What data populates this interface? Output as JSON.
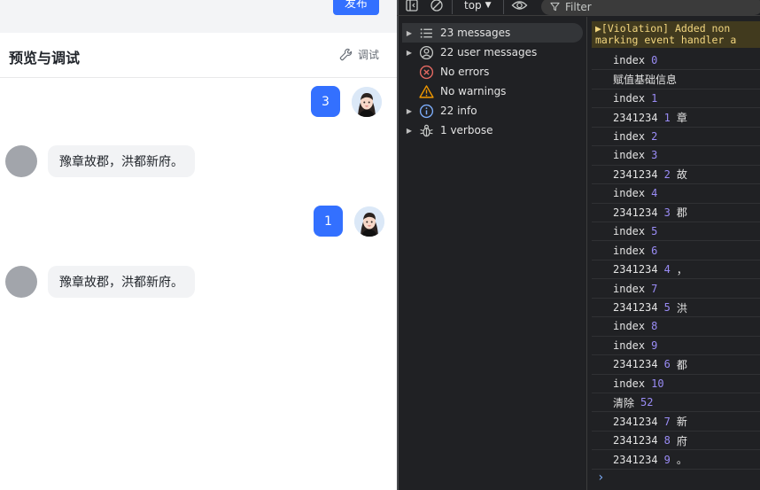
{
  "preview": {
    "publish_label": "发布",
    "title": "预览与调试",
    "debug_label": "调试",
    "messages": [
      {
        "role": "user",
        "text": "3"
      },
      {
        "role": "bot",
        "text": "豫章故郡，洪都新府。"
      },
      {
        "role": "user",
        "text": "1"
      },
      {
        "role": "bot",
        "text": "豫章故郡，洪都新府。"
      }
    ]
  },
  "devtools": {
    "context": "top",
    "filter_placeholder": "Filter",
    "sidebar": [
      {
        "label": "23 messages",
        "icon": "list-icon",
        "expandable": true,
        "active": true
      },
      {
        "label": "22 user messages",
        "icon": "user-circle-icon",
        "expandable": true
      },
      {
        "label": "No errors",
        "icon": "error-icon",
        "expandable": false
      },
      {
        "label": "No warnings",
        "icon": "warning-icon",
        "expandable": false
      },
      {
        "label": "22 info",
        "icon": "info-icon",
        "expandable": true
      },
      {
        "label": "1 verbose",
        "icon": "bug-icon",
        "expandable": true
      }
    ],
    "violation_line1": "▶[Violation] Added non",
    "violation_line2": "marking event handler a",
    "logs": [
      {
        "text": "index",
        "num": "0",
        "suffix": ""
      },
      {
        "text": "赋值基础信息",
        "num": "",
        "suffix": ""
      },
      {
        "text": "index",
        "num": "1",
        "suffix": ""
      },
      {
        "text": "2341234",
        "num": "1",
        "suffix": "章"
      },
      {
        "text": "index",
        "num": "2",
        "suffix": ""
      },
      {
        "text": "index",
        "num": "3",
        "suffix": ""
      },
      {
        "text": "2341234",
        "num": "2",
        "suffix": "故"
      },
      {
        "text": "index",
        "num": "4",
        "suffix": ""
      },
      {
        "text": "2341234",
        "num": "3",
        "suffix": "郡"
      },
      {
        "text": "index",
        "num": "5",
        "suffix": ""
      },
      {
        "text": "index",
        "num": "6",
        "suffix": ""
      },
      {
        "text": "2341234",
        "num": "4",
        "suffix": "，"
      },
      {
        "text": "index",
        "num": "7",
        "suffix": ""
      },
      {
        "text": "2341234",
        "num": "5",
        "suffix": "洪"
      },
      {
        "text": "index",
        "num": "8",
        "suffix": ""
      },
      {
        "text": "index",
        "num": "9",
        "suffix": ""
      },
      {
        "text": "2341234",
        "num": "6",
        "suffix": "都"
      },
      {
        "text": "index",
        "num": "10",
        "suffix": ""
      },
      {
        "text": "清除",
        "num": "52",
        "suffix": ""
      },
      {
        "text": "2341234",
        "num": "7",
        "suffix": "新"
      },
      {
        "text": "2341234",
        "num": "8",
        "suffix": "府"
      },
      {
        "text": "2341234",
        "num": "9",
        "suffix": "。"
      }
    ],
    "prompt_symbol": "›"
  },
  "colors": {
    "accent": "#3370ff",
    "devtools_bg": "#202124",
    "log_number": "#9a8cf6",
    "error": "#e46962",
    "warning": "#f29900",
    "info": "#7cacf8"
  }
}
